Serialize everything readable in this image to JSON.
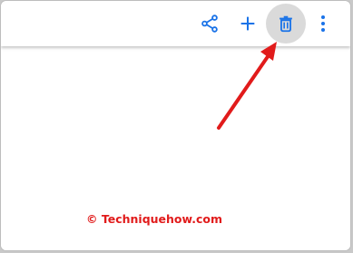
{
  "toolbar": {
    "actions": [
      {
        "name": "share",
        "icon": "share-icon"
      },
      {
        "name": "add",
        "icon": "plus-icon"
      },
      {
        "name": "delete",
        "icon": "trash-icon",
        "highlighted": true
      },
      {
        "name": "more",
        "icon": "more-vertical-icon"
      }
    ]
  },
  "annotation": {
    "arrow_color": "#e11b1b",
    "points_to": "delete"
  },
  "watermark": {
    "text": "© Techniquehow.com",
    "color": "#e11b1b"
  },
  "colors": {
    "icon_blue": "#1a73e8",
    "highlight_bg": "#dadada",
    "frame_bg": "#ffffff"
  }
}
